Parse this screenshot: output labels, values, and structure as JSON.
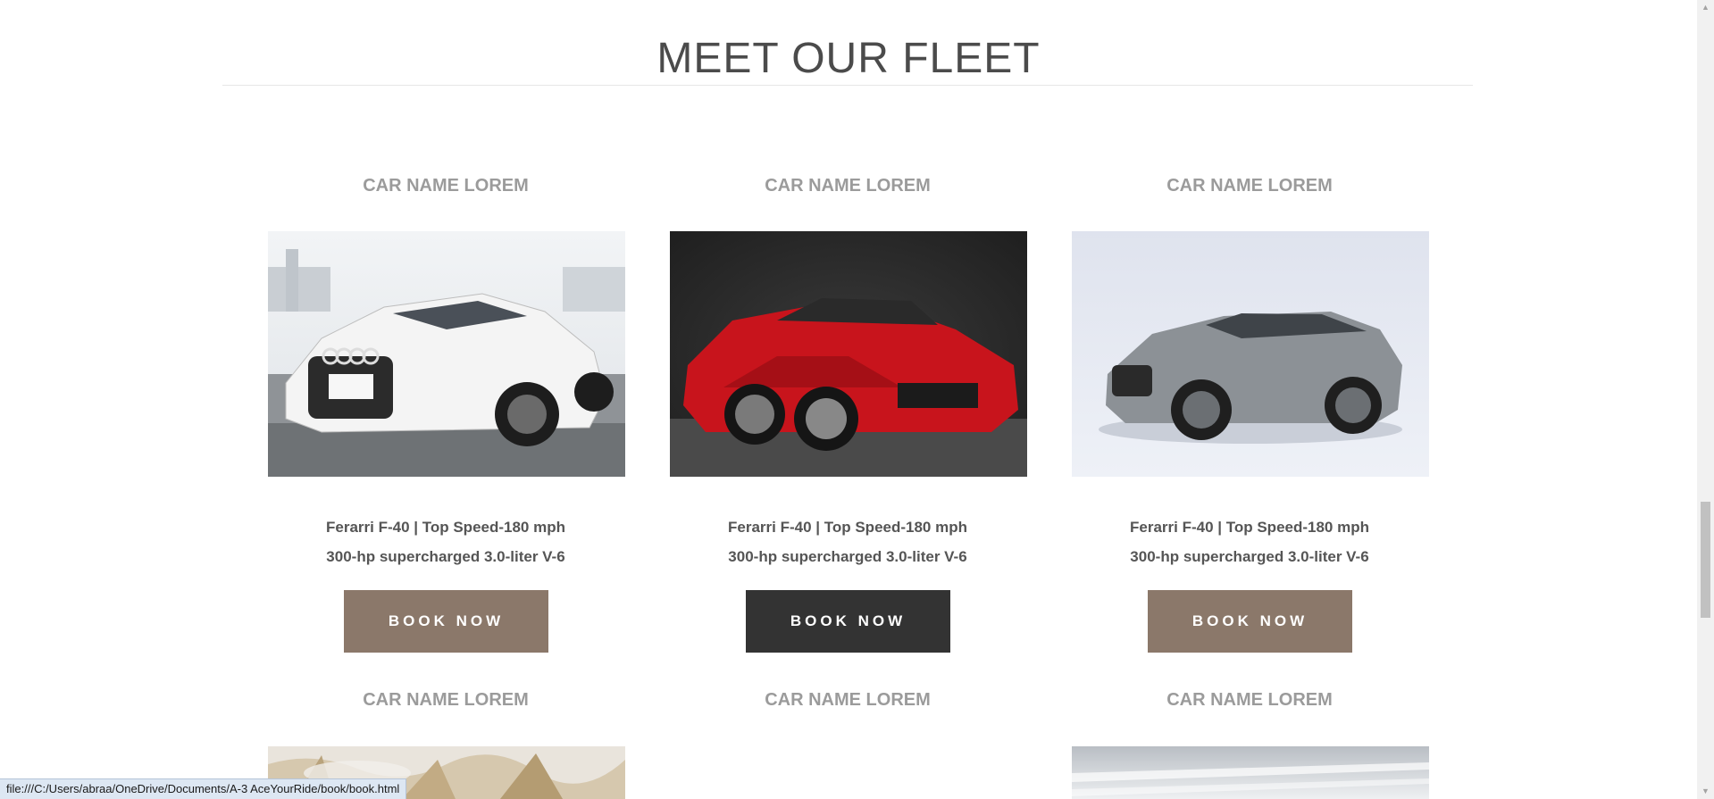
{
  "section": {
    "title": "MEET OUR FLEET"
  },
  "cars": [
    {
      "name": "CAR NAME LOREM",
      "spec_line1": "Ferarri F-40 | Top Speed-180 mph",
      "spec_line2": "300-hp supercharged 3.0-liter V-6",
      "button": "BOOK NOW",
      "button_color": "#8b786a",
      "image": "white-audi-sedan"
    },
    {
      "name": "CAR NAME LOREM",
      "spec_line1": "Ferarri F-40 | Top Speed-180 mph",
      "spec_line2": "300-hp supercharged 3.0-liter V-6",
      "button": "BOOK NOW",
      "button_color": "#333333",
      "image": "red-ferrari-coupe"
    },
    {
      "name": "CAR NAME LOREM",
      "spec_line1": "Ferarri F-40 | Top Speed-180 mph",
      "spec_line2": "300-hp supercharged 3.0-liter V-6",
      "button": "BOOK NOW",
      "button_color": "#8b786a",
      "image": "grey-jaguar-suv"
    },
    {
      "name": "CAR NAME LOREM",
      "image": "desert-car-photo"
    },
    {
      "name": "CAR NAME LOREM"
    },
    {
      "name": "CAR NAME LOREM",
      "image": "silver-car-photo"
    }
  ],
  "status_bar": {
    "url": "file:///C:/Users/abraa/OneDrive/Documents/A-3 AceYourRide/book/book.html"
  },
  "colors": {
    "accent_brown": "#8b786a",
    "dark": "#333333",
    "title": "#4b4b4b",
    "muted": "#9b9b9b"
  }
}
